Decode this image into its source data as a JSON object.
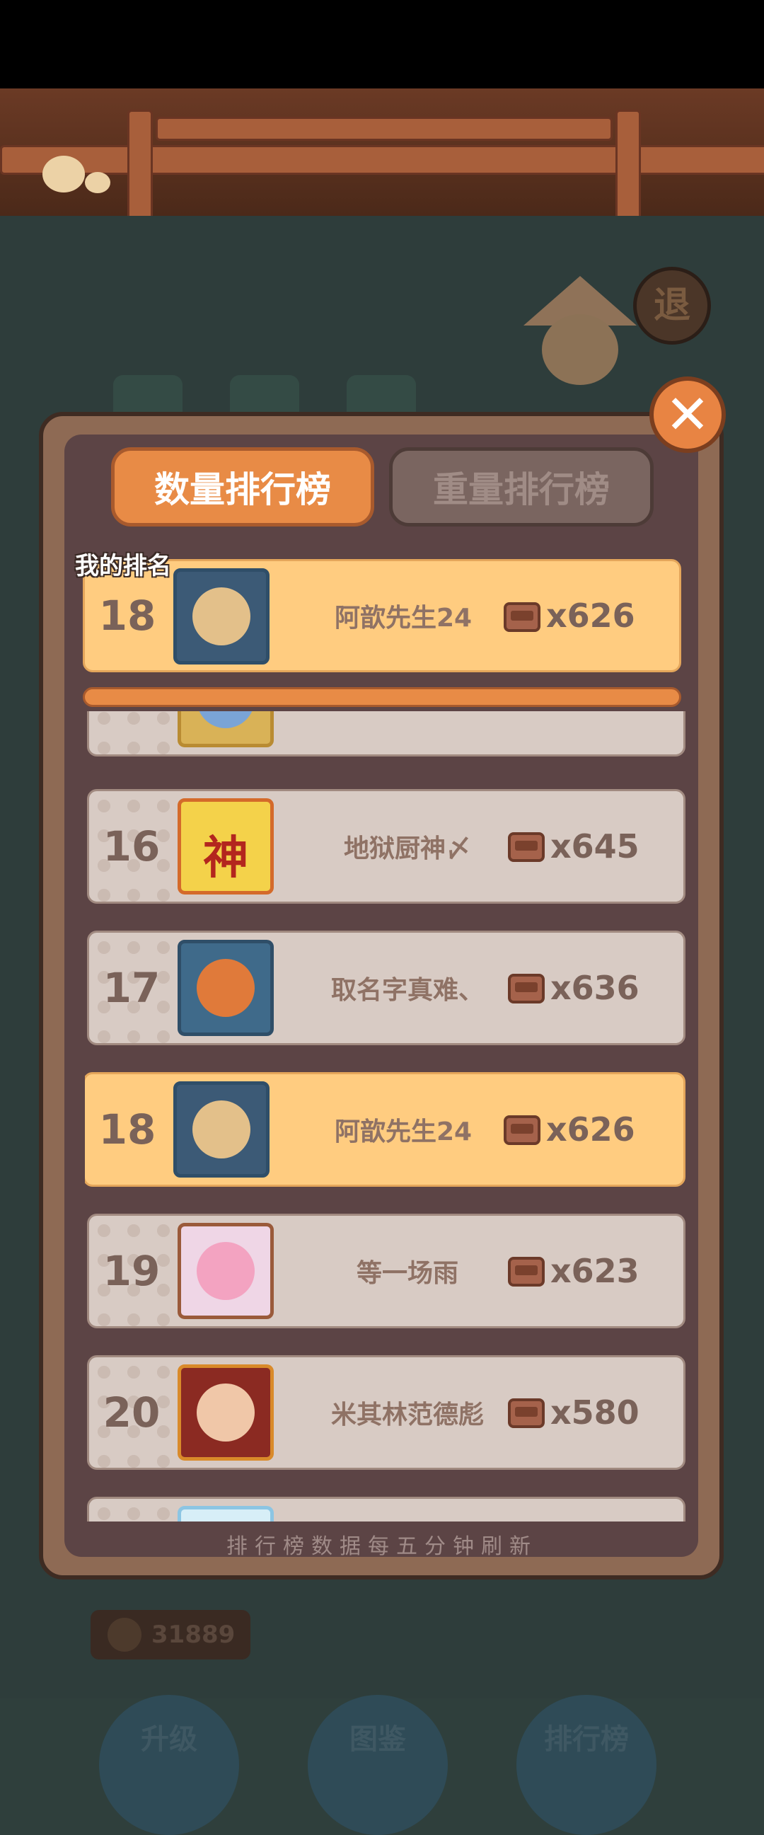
{
  "header_tabs": [
    {
      "label": "数量排行榜",
      "active": true
    },
    {
      "label": "重量排行榜",
      "active": false
    }
  ],
  "close_label": "✕",
  "exit_label": "退",
  "my_rank": {
    "label": "我的排名",
    "rank": "18",
    "name": "阿歆先生24",
    "count": "x626",
    "avatar_icon": "blonde-boy-avatar"
  },
  "ranking": [
    {
      "rank": "",
      "name": "",
      "count": "",
      "avatar_icon": "blue-frame-avatar",
      "partial": "top"
    },
    {
      "rank": "16",
      "name": "地狱厨神〆",
      "count": "x645",
      "avatar_icon": "shen-character-avatar",
      "avatar_text": "神"
    },
    {
      "rank": "17",
      "name": "取名字真难、",
      "count": "x636",
      "avatar_icon": "fox-avatar"
    },
    {
      "rank": "18",
      "name": "阿歆先生24",
      "count": "x626",
      "avatar_icon": "blonde-boy-avatar",
      "highlight": true
    },
    {
      "rank": "19",
      "name": "等一场雨",
      "count": "x623",
      "avatar_icon": "pink-bunny-avatar"
    },
    {
      "rank": "20",
      "name": "米其林范德彪",
      "count": "x580",
      "avatar_icon": "red-hair-boy-avatar"
    },
    {
      "rank": "",
      "name": "",
      "count": "",
      "avatar_icon": "cloud-frame-avatar",
      "partial": "bottom"
    }
  ],
  "footer_note": "排行榜数据每五分钟刷新",
  "background": {
    "bottom_buttons": [
      "升级",
      "图鉴",
      "排行榜"
    ],
    "coins": "31889"
  },
  "colors": {
    "accent": "#e88b46",
    "highlight_row": "#ffcc80",
    "panel": "#5c4445"
  }
}
